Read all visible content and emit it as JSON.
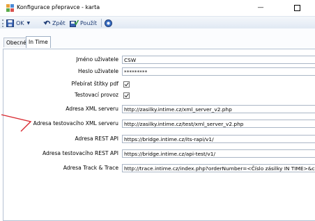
{
  "window": {
    "title": "Konfigurace přepravce - karta"
  },
  "toolbar": {
    "ok_label": "OK",
    "back_label": "Zpět",
    "apply_label": "Použít"
  },
  "tabs": [
    {
      "label": "Obecné"
    },
    {
      "label": "In Time"
    }
  ],
  "form": {
    "username": {
      "label": "Jméno uživatele",
      "value": "CSW"
    },
    "password": {
      "label": "Heslo uživatele",
      "value": "*********"
    },
    "take_pdf_labels": {
      "label": "Přebírat štítky pdf",
      "checked": true
    },
    "test_mode": {
      "label": "Testovací provoz",
      "checked": true
    },
    "xml_server": {
      "label": "Adresa XML serveru",
      "value": "http://zasilky.intime.cz/xml_server_v2.php"
    },
    "test_xml_server": {
      "label": "Adresa testovacího XML serveru",
      "value": "http://zasilky.intime.cz/test/xml_server_v2.php"
    },
    "rest_api": {
      "label": "Adresa REST API",
      "value": "https://bridge.intime.cz/its-rapi/v1/"
    },
    "test_rest_api": {
      "label": "Adresa testovacího REST API",
      "value": "https://bridge.intime.cz/api-test/v1/"
    },
    "track_trace": {
      "label": "Adresa Track & Trace",
      "value": "http://trace.intime.cz/index.php?orderNumber=<Číslo zásilky IN TIME>&c"
    }
  },
  "colors": {
    "annotation_arrow": "#d9282f",
    "toolbar_text": "#1d3b74"
  }
}
